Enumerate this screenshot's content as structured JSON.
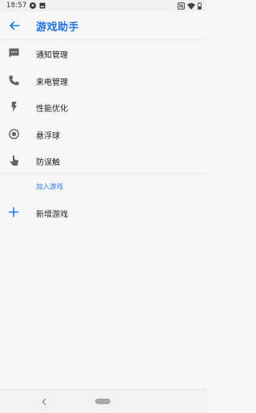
{
  "status_bar": {
    "time": "18:57"
  },
  "header": {
    "title": "游戏助手",
    "accent_color": "#1e73e8"
  },
  "menu": {
    "items": [
      {
        "label": "通知管理",
        "icon": "message-dots-icon"
      },
      {
        "label": "来电管理",
        "icon": "phone-icon"
      },
      {
        "label": "性能优化",
        "icon": "lightning-icon"
      },
      {
        "label": "悬浮球",
        "icon": "radio-target-icon"
      },
      {
        "label": "防误触",
        "icon": "touch-hand-icon"
      }
    ]
  },
  "games_section": {
    "header": "加入游戏",
    "add_label": "新增游戏",
    "add_icon": "plus-icon"
  }
}
